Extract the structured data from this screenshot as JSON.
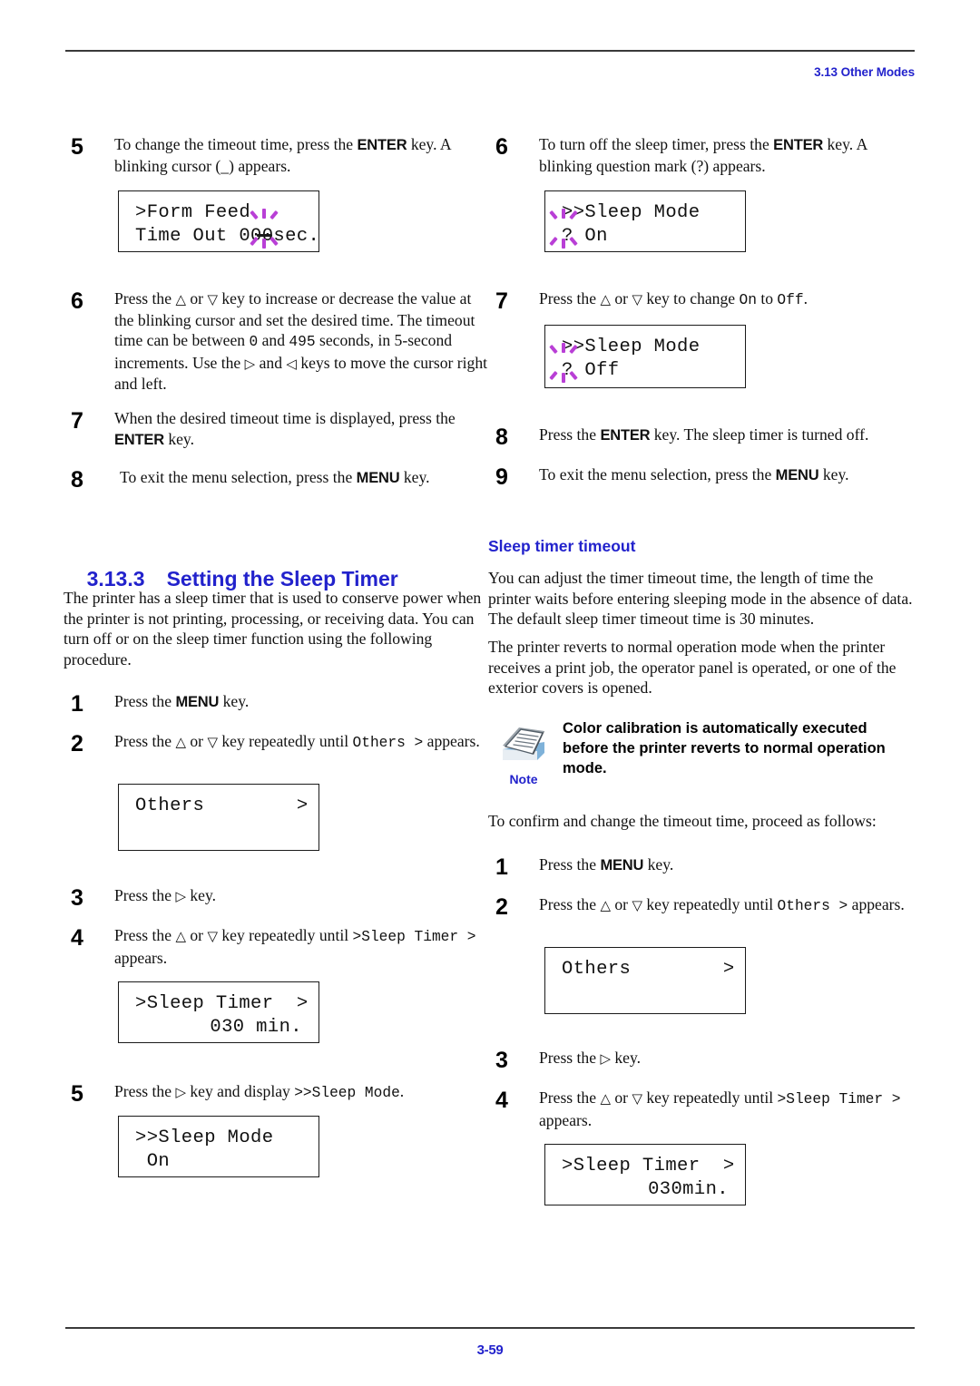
{
  "header": {
    "section": "3.13 Other Modes"
  },
  "footer": {
    "page_number": "3-59"
  },
  "colors": {
    "accent_blue": "#2222CC",
    "blink_purple": "#B93FD6",
    "rule_gray": "#3A3A3A"
  },
  "left_column": {
    "step5": {
      "num": "5",
      "text_a": "To change the timeout time, press the ",
      "key": "ENTER",
      "text_b": " key. A blinking cursor (_) appears.",
      "lcd_line1": ">Form Feed",
      "lcd_line2": "Time Out 000sec."
    },
    "step6": {
      "num": "6",
      "text_a": "Press the ",
      "up": "△",
      "mid_a": " or ",
      "down": "▽",
      "mid_b": " key to increase or decrease the value at the blinking cursor and set the desired time. The timeout time can be between ",
      "val_min": "0",
      "mid_c": " and ",
      "val_max": "495",
      "mid_d": " seconds, in 5-second increments. Use the ",
      "right": "▷",
      "mid_e": " and ",
      "left": "◁",
      "mid_f": " keys to move the cursor right and left."
    },
    "step7": {
      "num": "7",
      "text_a": "When the desired timeout time is displayed, press the ",
      "key": "ENTER",
      "text_b": " key."
    },
    "step8": {
      "num": "8",
      "text_a": "To exit the menu selection, press the ",
      "key": "MENU",
      "text_b": " key."
    },
    "heading": {
      "number": "3.13.3",
      "title": "Setting the Sleep Timer"
    },
    "intro": "The printer has a sleep timer that is used to conserve power when the printer is not printing, processing, or receiving data. You can turn off or on the sleep timer function using the following procedure.",
    "p_step1": {
      "num": "1",
      "text_a": "Press the ",
      "key": "MENU",
      "text_b": " key."
    },
    "p_step2": {
      "num": "2",
      "text_a": "Press the ",
      "up": "△",
      "mid_a": " or ",
      "down": "▽",
      "mid_b": " key repeatedly until ",
      "mono": "Others  >",
      "text_b": " appears.",
      "lcd_line1": "Others        >",
      "lcd_line2": ""
    },
    "p_step3": {
      "num": "3",
      "text_a": "Press the ",
      "right": "▷",
      "text_b": " key."
    },
    "p_step4": {
      "num": "4",
      "text_a": "Press the ",
      "up": "△",
      "mid_a": " or ",
      "down": "▽",
      "mid_b": " key repeatedly until ",
      "mono": ">Sleep Timer  >",
      "text_b": " appears.",
      "lcd_line1": ">Sleep Timer  >",
      "lcd_line2": "030 min."
    },
    "p_step5": {
      "num": "5",
      "text_a": "Press the ",
      "right": "▷",
      "text_b": " key and display ",
      "mono": ">>Sleep Mode",
      "text_c": ".",
      "lcd_line1": ">>Sleep Mode",
      "lcd_line2": " On"
    }
  },
  "right_column": {
    "step6": {
      "num": "6",
      "text_a": "To turn off the sleep timer, press the ",
      "key": "ENTER",
      "text_b": " key. A blinking question mark (?) appears.",
      "lcd_line1": ">>Sleep Mode",
      "lcd_line2": "? On"
    },
    "step7": {
      "num": "7",
      "text_a": "Press the ",
      "up": "△",
      "mid_a": " or ",
      "down": "▽",
      "mid_b": " key to change ",
      "mono_on": "On",
      "mid_c": " to ",
      "mono_off": "Off",
      "text_b": ".",
      "lcd_line1": ">>Sleep Mode",
      "lcd_line2": "? Off"
    },
    "step8": {
      "num": "8",
      "text_a": "Press the ",
      "key": "ENTER",
      "text_b": " key. The sleep timer is turned off."
    },
    "step9": {
      "num": "9",
      "text_a": "To exit the menu selection, press the ",
      "key": "MENU",
      "text_b": " key."
    },
    "heading": "Sleep timer timeout",
    "para1": "You can adjust the timer timeout time, the length of time the printer waits before entering sleeping mode in the absence of data. The default sleep timer timeout time is 30 minutes.",
    "para2": "The printer reverts to normal operation mode when the printer receives a print job, the operator panel is operated, or one of the exterior covers is opened.",
    "note": {
      "label": "Note",
      "text": "Color calibration is automatically executed before the printer reverts to normal operation mode."
    },
    "lead_in": "To confirm and change the timeout time, proceed as follows:",
    "p_step1": {
      "num": "1",
      "text_a": "Press the ",
      "key": "MENU",
      "text_b": " key."
    },
    "p_step2": {
      "num": "2",
      "text_a": "Press the ",
      "up": "△",
      "mid_a": " or ",
      "down": "▽",
      "mid_b": " key repeatedly until ",
      "mono": "Others  >",
      "text_b": " appears.",
      "lcd_line1": "Others        >",
      "lcd_line2": ""
    },
    "p_step3": {
      "num": "3",
      "text_a": "Press the ",
      "right": "▷",
      "text_b": " key."
    },
    "p_step4": {
      "num": "4",
      "text_a": "Press the ",
      "up": "△",
      "mid_a": " or ",
      "down": "▽",
      "mid_b": " key repeatedly until ",
      "mono": ">Sleep Timer  >",
      "text_b": " appears.",
      "lcd_line1": ">Sleep Timer  >",
      "lcd_line2": "030min."
    }
  }
}
